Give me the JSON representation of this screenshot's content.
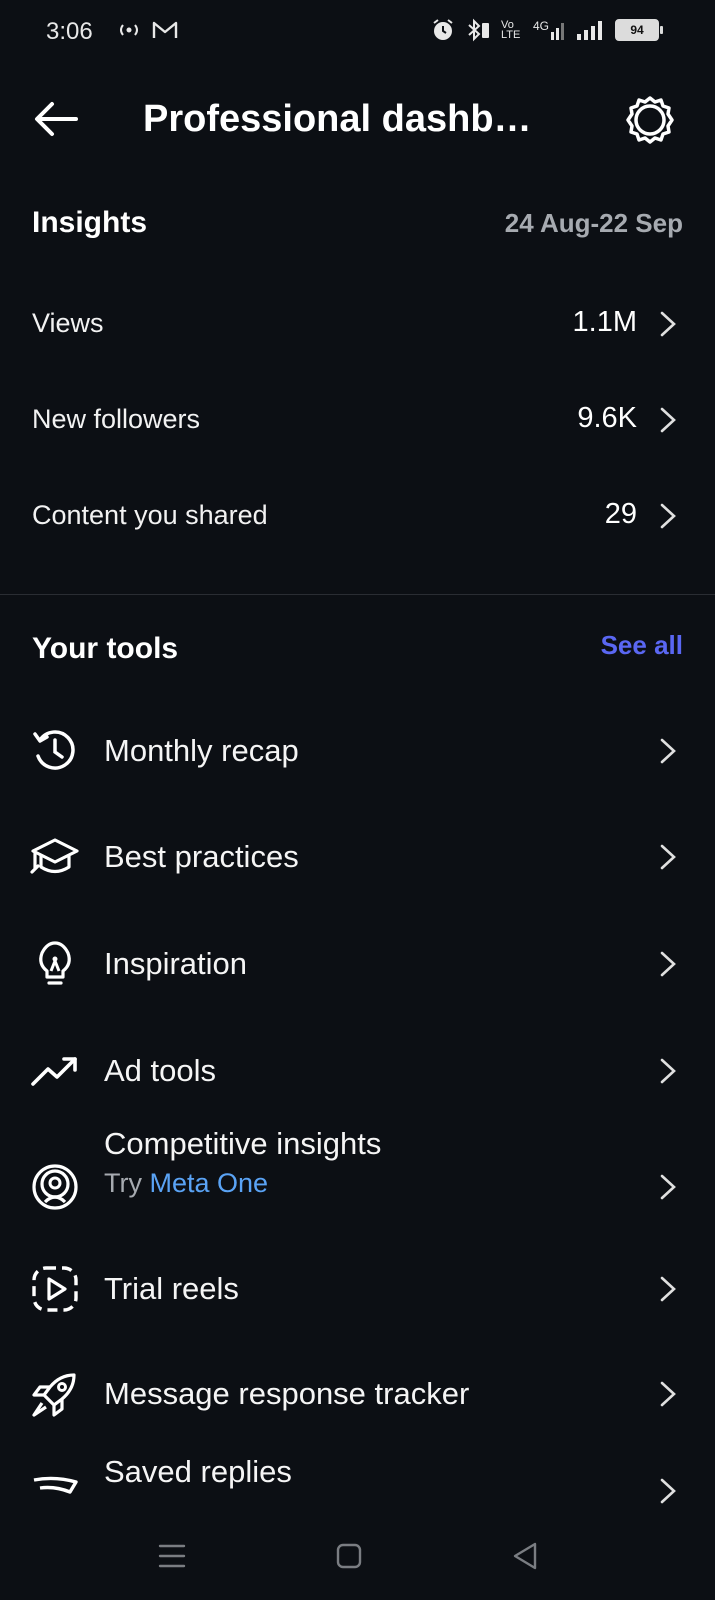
{
  "status_bar": {
    "time": "3:06",
    "left_icons": [
      "hotspot-icon",
      "gmail-icon"
    ],
    "volte": "Vo LTE",
    "network": "4G",
    "battery": "94"
  },
  "header": {
    "title": "Professional dashb…",
    "back_icon": "arrow-left-icon",
    "settings_icon": "gear-icon"
  },
  "insights": {
    "title": "Insights",
    "date_range": "24 Aug-22 Sep",
    "metrics": [
      {
        "label": "Views",
        "value": "1.1M"
      },
      {
        "label": "New followers",
        "value": "9.6K"
      },
      {
        "label": "Content you shared",
        "value": "29"
      }
    ]
  },
  "tools": {
    "title": "Your tools",
    "see_all": "See all",
    "items": [
      {
        "label": "Monthly recap",
        "icon": "history-icon"
      },
      {
        "label": "Best practices",
        "icon": "graduation-cap-icon"
      },
      {
        "label": "Inspiration",
        "icon": "lightbulb-icon"
      },
      {
        "label": "Ad tools",
        "icon": "trending-up-icon"
      },
      {
        "label": "Competitive insights",
        "icon": "target-person-icon",
        "sub_prefix": "Try",
        "sub_link": "Meta One"
      },
      {
        "label": "Trial reels",
        "icon": "dashed-play-icon"
      },
      {
        "label": "Message response tracker",
        "icon": "rocket-icon"
      },
      {
        "label": "Saved replies",
        "icon": "reply-icon"
      }
    ]
  },
  "colors": {
    "background": "#0c0f14",
    "accent_link": "#5a67f2",
    "meta_one_link": "#5aa3f5",
    "secondary_text": "#a6aab0"
  },
  "navigation_bar": [
    "menu-icon",
    "home-square-icon",
    "back-triangle-icon"
  ]
}
